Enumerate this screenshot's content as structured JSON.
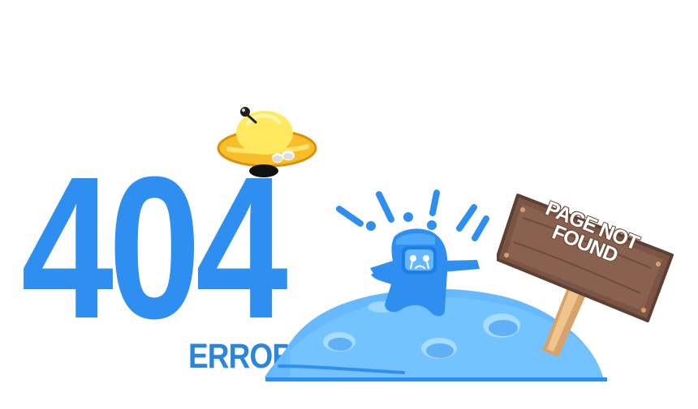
{
  "error_page": {
    "code": "404",
    "label": "ERROR",
    "sign_text": "PAGE NOT FOUND"
  },
  "colors": {
    "accent_blue": "#2f8ff1",
    "label_blue": "#2a86d9",
    "moon_blue": "#67b8ff",
    "crater_blue": "#8ed0ff",
    "ufo_yellow": "#f7bf27",
    "ufo_dome": "#ffe86a",
    "sign_brown": "#7e5646",
    "post_wood": "#d8a56a"
  },
  "icons": {
    "ufo": "ufo-icon",
    "robot": "robot-mascot-icon",
    "moon": "moon-surface-icon",
    "sign": "wooden-sign-icon"
  }
}
